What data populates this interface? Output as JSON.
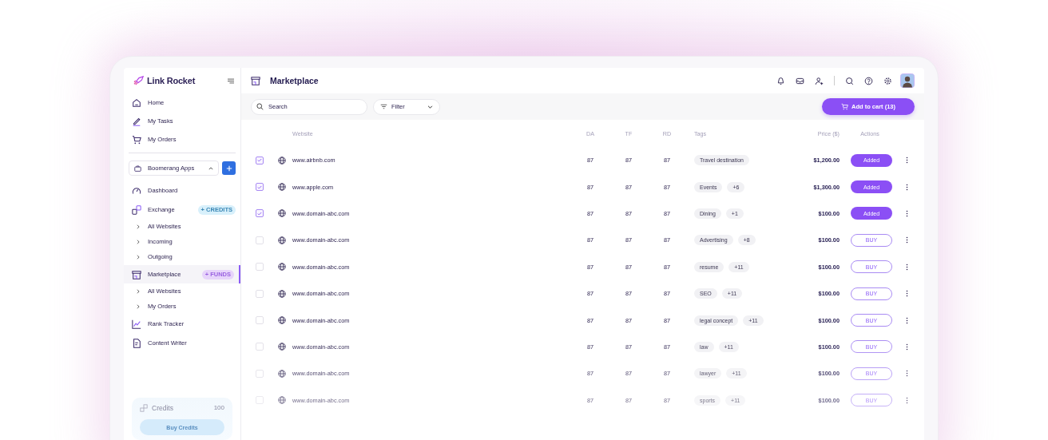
{
  "sidebar": {
    "logo": "Link Rocket",
    "top_items": [
      {
        "label": "Home"
      },
      {
        "label": "My Tasks"
      },
      {
        "label": "My Orders"
      }
    ],
    "workspace": {
      "label": "Boomerang Apps"
    },
    "items": [
      {
        "label": "Dashboard",
        "selected": false
      },
      {
        "label": "Exchange",
        "badge": "+ CREDITS",
        "selected": false,
        "children": [
          {
            "label": "All Websites"
          },
          {
            "label": "Incoming"
          },
          {
            "label": "Outgoing"
          }
        ]
      },
      {
        "label": "Marketplace",
        "badge": "+ FUNDS",
        "selected": true,
        "children": [
          {
            "label": "All Websites"
          },
          {
            "label": "My Orders"
          }
        ]
      },
      {
        "label": "Rank Tracker",
        "selected": false
      },
      {
        "label": "Content Writer",
        "selected": false
      }
    ],
    "credits": {
      "label": "Credits",
      "value": "100",
      "button": "Buy Credits"
    }
  },
  "header": {
    "title": "Marketplace"
  },
  "toolbar": {
    "search": {
      "placeholder": "Search"
    },
    "filter": {
      "label": "Filter"
    },
    "cart_button": "Add to cart (13)"
  },
  "table": {
    "columns": [
      "Website",
      "DA",
      "TF",
      "RD",
      "Tags",
      "Price ($)",
      "Actions"
    ],
    "rows": [
      {
        "checked": true,
        "website": "www.airbnb.com",
        "da": "87",
        "tf": "87",
        "rd": "87",
        "tags": [
          "Travel destination"
        ],
        "price": "$1,200.00",
        "added": true,
        "action": "Added"
      },
      {
        "checked": true,
        "website": "www.apple.com",
        "da": "87",
        "tf": "87",
        "rd": "87",
        "tags": [
          "Events",
          "+6"
        ],
        "price": "$1,300.00",
        "added": true,
        "action": "Added"
      },
      {
        "checked": true,
        "website": "www.domain-abc.com",
        "da": "87",
        "tf": "87",
        "rd": "87",
        "tags": [
          "Dining",
          "+1"
        ],
        "price": "$100.00",
        "added": true,
        "action": "Added"
      },
      {
        "checked": false,
        "website": "www.domain-abc.com",
        "da": "87",
        "tf": "87",
        "rd": "87",
        "tags": [
          "Advertising",
          "+8"
        ],
        "price": "$100.00",
        "added": false,
        "action": "BUY"
      },
      {
        "checked": false,
        "website": "www.domain-abc.com",
        "da": "87",
        "tf": "87",
        "rd": "87",
        "tags": [
          "resume",
          "+11"
        ],
        "price": "$100.00",
        "added": false,
        "action": "BUY"
      },
      {
        "checked": false,
        "website": "www.domain-abc.com",
        "da": "87",
        "tf": "87",
        "rd": "87",
        "tags": [
          "SEO",
          "+11"
        ],
        "price": "$100.00",
        "added": false,
        "action": "BUY"
      },
      {
        "checked": false,
        "website": "www.domain-abc.com",
        "da": "87",
        "tf": "87",
        "rd": "87",
        "tags": [
          "legal concept",
          "+11"
        ],
        "price": "$100.00",
        "added": false,
        "action": "BUY"
      },
      {
        "checked": false,
        "website": "www.domain-abc.com",
        "da": "87",
        "tf": "87",
        "rd": "87",
        "tags": [
          "law",
          "+11"
        ],
        "price": "$100.00",
        "added": false,
        "action": "BUY"
      },
      {
        "checked": false,
        "website": "www.domain-abc.com",
        "da": "87",
        "tf": "87",
        "rd": "87",
        "tags": [
          "lawyer",
          "+11"
        ],
        "price": "$100.00",
        "added": false,
        "action": "BUY"
      },
      {
        "checked": false,
        "website": "www.domain-abc.com",
        "da": "87",
        "tf": "87",
        "rd": "87",
        "tags": [
          "sports",
          "+11"
        ],
        "price": "$100.00",
        "added": false,
        "action": "BUY"
      }
    ]
  }
}
